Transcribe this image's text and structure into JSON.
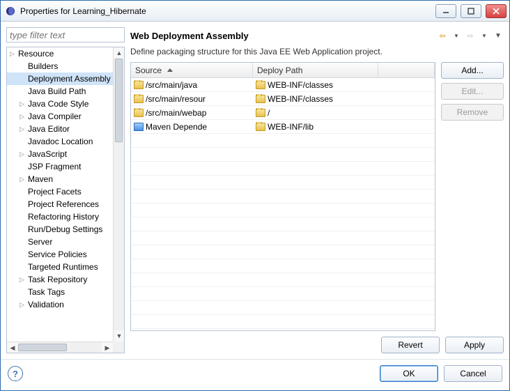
{
  "window": {
    "title": "Properties for Learning_Hibernate"
  },
  "filter": {
    "placeholder": "type filter text"
  },
  "tree": [
    {
      "label": "Resource",
      "expandable": true,
      "level": 0
    },
    {
      "label": "Builders",
      "level": 1
    },
    {
      "label": "Deployment Assembly",
      "level": 1,
      "selected": true
    },
    {
      "label": "Java Build Path",
      "level": 1
    },
    {
      "label": "Java Code Style",
      "expandable": true,
      "level": 1
    },
    {
      "label": "Java Compiler",
      "expandable": true,
      "level": 1
    },
    {
      "label": "Java Editor",
      "expandable": true,
      "level": 1
    },
    {
      "label": "Javadoc Location",
      "level": 1
    },
    {
      "label": "JavaScript",
      "expandable": true,
      "level": 1
    },
    {
      "label": "JSP Fragment",
      "level": 1
    },
    {
      "label": "Maven",
      "expandable": true,
      "level": 1
    },
    {
      "label": "Project Facets",
      "level": 1
    },
    {
      "label": "Project References",
      "level": 1
    },
    {
      "label": "Refactoring History",
      "level": 1
    },
    {
      "label": "Run/Debug Settings",
      "level": 1
    },
    {
      "label": "Server",
      "level": 1
    },
    {
      "label": "Service Policies",
      "level": 1
    },
    {
      "label": "Targeted Runtimes",
      "level": 1
    },
    {
      "label": "Task Repository",
      "expandable": true,
      "level": 1
    },
    {
      "label": "Task Tags",
      "level": 1
    },
    {
      "label": "Validation",
      "expandable": true,
      "level": 1
    }
  ],
  "panel": {
    "title": "Web Deployment Assembly",
    "description": "Define packaging structure for this Java EE Web Application project.",
    "columns": {
      "source": "Source",
      "deploy": "Deploy Path"
    },
    "rows": [
      {
        "icon": "folder",
        "source": "/src/main/java",
        "deploy": "WEB-INF/classes"
      },
      {
        "icon": "folder",
        "source": "/src/main/resour",
        "deploy": "WEB-INF/classes"
      },
      {
        "icon": "folder",
        "source": "/src/main/webap",
        "deploy": "/"
      },
      {
        "icon": "jar",
        "source": "Maven Depende",
        "deploy": "WEB-INF/lib"
      }
    ],
    "buttons": {
      "add": "Add...",
      "edit": "Edit...",
      "remove": "Remove",
      "revert": "Revert",
      "apply": "Apply"
    }
  },
  "footer": {
    "ok": "OK",
    "cancel": "Cancel"
  }
}
